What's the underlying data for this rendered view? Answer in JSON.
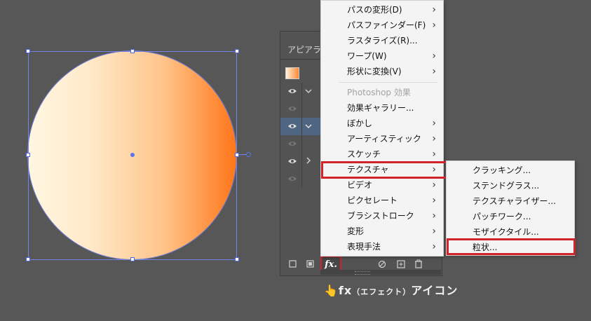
{
  "panel": {
    "title": "アピアランス",
    "fx_label": "fx."
  },
  "main_menu": {
    "items": [
      {
        "label": "パスの変形(D)",
        "submenu": true
      },
      {
        "label": "パスファインダー(F)",
        "submenu": true
      },
      {
        "label": "ラスタライズ(R)...",
        "submenu": false
      },
      {
        "label": "ワープ(W)",
        "submenu": true
      },
      {
        "label": "形状に変換(V)",
        "submenu": true
      },
      {
        "label": "Photoshop 効果",
        "disabled": true
      },
      {
        "label": "効果ギャラリー...",
        "submenu": false
      },
      {
        "label": "ぼかし",
        "submenu": true
      },
      {
        "label": "アーティスティック",
        "submenu": true
      },
      {
        "label": "スケッチ",
        "submenu": true
      },
      {
        "label": "テクスチャ",
        "submenu": true,
        "highlighted": true
      },
      {
        "label": "ビデオ",
        "submenu": true
      },
      {
        "label": "ピクセレート",
        "submenu": true
      },
      {
        "label": "ブラシストローク",
        "submenu": true
      },
      {
        "label": "変形",
        "submenu": true
      },
      {
        "label": "表現手法",
        "submenu": true
      }
    ]
  },
  "texture_submenu": {
    "items": [
      {
        "label": "クラッキング..."
      },
      {
        "label": "ステンドグラス..."
      },
      {
        "label": "テクスチャライザー..."
      },
      {
        "label": "パッチワーク..."
      },
      {
        "label": "モザイクタイル..."
      },
      {
        "label": "粒状...",
        "highlighted": true
      }
    ]
  },
  "arrow_glyph": "›",
  "caption": {
    "pointer": "👆",
    "prefix": "fx",
    "paren": "（エフェクト）",
    "suffix": "アイコン"
  },
  "colors": {
    "gradient_start": "#fff7e2",
    "gradient_end": "#ff7619",
    "highlight": "#d2232a",
    "selection": "#4e66dd"
  }
}
